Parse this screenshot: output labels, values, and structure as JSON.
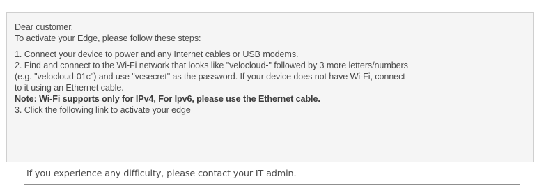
{
  "email": {
    "greeting": "Dear customer,",
    "intro": "To activate your Edge, please follow these steps:",
    "step_1": "1. Connect your device to power and any Internet cables or USB modems.",
    "step_2_line_1": "2. Find and connect to the Wi-Fi network that looks like \"velocloud-\" followed by 3 more letters/numbers",
    "step_2_line_2": "(e.g. \"velocloud-01c\") and use \"vcsecret\" as the password. If your device does not have Wi-Fi, connect",
    "step_2_line_3": "to it using an Ethernet cable.",
    "note": "Note: Wi-Fi supports only for IPv4, For Ipv6, please use the Ethernet cable.",
    "step_3": "3. Click the following link to activate your edge"
  },
  "footer": {
    "support_text": "If you experience any difficulty, please contact your IT admin."
  }
}
